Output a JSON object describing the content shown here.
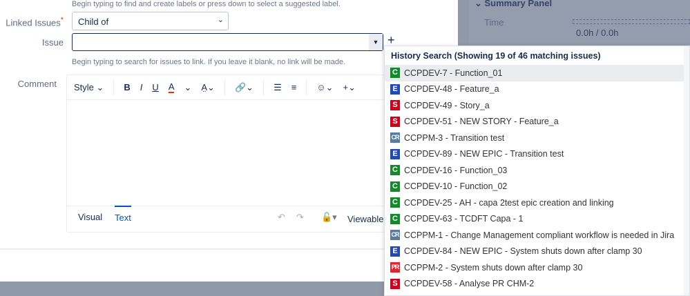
{
  "form": {
    "labels_hint": "Begin typing to find and create labels or press down to select a suggested label.",
    "linked_issues_label": "Linked Issues",
    "required_mark": "*",
    "link_type": "Child of",
    "issue_label": "Issue",
    "issue_value": "",
    "issue_hint": "Begin typing to search for issues to link. If you leave it blank, no link will be made.",
    "add": "+",
    "comment_label": "Comment"
  },
  "editor": {
    "toolbar": [
      "Style ⌄",
      "B",
      "I",
      "U",
      "A",
      "⌄",
      "A̤⌄",
      "🔗⌄",
      "☰",
      "≡",
      "☺⌄",
      "+⌄"
    ],
    "tabs": {
      "visual": "Visual",
      "text": "Text"
    },
    "viewable": "Viewable",
    "undo": "↶",
    "redo": "↷",
    "lock": "🔓▾"
  },
  "summary": {
    "title": "Summary Panel",
    "time_label": "Time",
    "time_value": "0.0h / 0.0h"
  },
  "dropdown": {
    "header": "History Search (Showing 19 of 46 matching issues)",
    "type_colors": {
      "C": "#14892c",
      "E": "#2049b7",
      "S": "#d0021b",
      "CR": "#5a7aa0",
      "PR": "#e3242b"
    },
    "items": [
      {
        "type": "C",
        "text": "CCPDEV-7 - Function_01"
      },
      {
        "type": "E",
        "text": "CCPDEV-48 - Feature_a"
      },
      {
        "type": "S",
        "text": "CCPDEV-49 - Story_a"
      },
      {
        "type": "S",
        "text": "CCPDEV-51 - NEW STORY - Feature_a"
      },
      {
        "type": "CR",
        "text": "CCPPM-3 - Transition test"
      },
      {
        "type": "E",
        "text": "CCPDEV-89 - NEW EPIC - Transition test"
      },
      {
        "type": "C",
        "text": "CCPDEV-16 - Function_03"
      },
      {
        "type": "C",
        "text": "CCPDEV-10 - Function_02"
      },
      {
        "type": "C",
        "text": "CCPDEV-25 - AH - capa 2test epic creation and linking"
      },
      {
        "type": "C",
        "text": "CCPDEV-63 - TCDFT Capa - 1"
      },
      {
        "type": "CR",
        "text": "CCPPM-1 - Change Management compliant workflow is needed in Jira"
      },
      {
        "type": "E",
        "text": "CCPDEV-84 - NEW EPIC - System shuts down after clamp 30"
      },
      {
        "type": "PR",
        "text": "CCPPM-2 - System shuts down after clamp 30"
      },
      {
        "type": "S",
        "text": "CCPDEV-58 - Analyse PR CHM-2"
      }
    ]
  }
}
